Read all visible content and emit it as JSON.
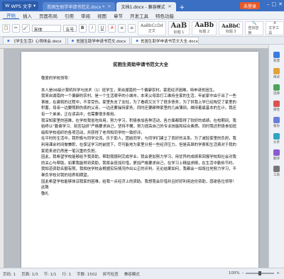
{
  "titlebar": {
    "app_label": "WPS 文字",
    "tabs": [
      {
        "label": "贫困生助学申请书范文.docx *"
      },
      {
        "label": "文档1.docx - 兼容模式"
      }
    ],
    "login_label": "未登录"
  },
  "menu": {
    "items": [
      "开始",
      "插入",
      "页面布局",
      "引用",
      "审阅",
      "视图",
      "章节",
      "开发工具",
      "特色功能"
    ]
  },
  "ribbon": {
    "font": "宋体",
    "size": "五号",
    "styles": [
      {
        "preview": "AaBbCcDd",
        "name": "正文"
      },
      {
        "preview": "AaB",
        "name": "标题 1"
      },
      {
        "preview": "AaBb",
        "name": "标题 2"
      },
      {
        "preview": "AaBbC",
        "name": "标题 3"
      }
    ],
    "find_label": "查找替换",
    "select_label": "选择",
    "tools_label": "文字工具"
  },
  "quickbar": {
    "tabs": [
      {
        "label": "《学生生活》心得体会.docx"
      },
      {
        "label": "贫困生助学申请书范文.docx"
      },
      {
        "label": "贫困生助学申请书范文大全.docx"
      }
    ]
  },
  "document": {
    "title": "贫困生资助申请书范文大全",
    "salutation": "敬爱的学校领导：",
    "paragraphs": [
      "本人是06级计算机科学与技术（1）班学生，来自湖南的一个偏僻农村。家庭经济困难，特申请贫困生。",
      "我来自湖南的一个偏僻的农村。是一个生活艰辛的小城市，本来父母靠打工维持全家的生活，年前家中由于出了一些事故，在建筑的过程中，不幸受伤。家里失去了支柱，为了看病又欠下了很多债务，为了供我上学已经掏空了家里的积蓄。母亲一边要照顾伤病的父亲，一边还要操持家务，同时还要耕种家里的几亩薄田，维持着最基本的生计。我还有一个弟弟，正在读高中，也需要很多费用。",
      "我深知家里的困难，在学校我省吃俭用，努力学习，积极参加各种活动，各方面都取得了较好的成绩。在校期间，我始终以“勤奋学习、刻苦钻研”严格要求自己，坚持不懈，努力提高自己的专业技能和综合素质。同时我还积极参加班级和学校组织的各项活动，并获得了老师和同学的一致好评。",
      "在平时的生活中，我积极与同学交流，乐于助人，团结同学，与同学们建立了良好的关系。为了减轻家里的负担，我利用课余时间做兼职，在保证学习的前提下，尽可能地为家里分担一些经济压力。但是高昂的学费和生活费对于我的家庭来说仍然是一笔沉重的负担。",
      "因此，我希望学校能够给予我资助，帮助我顺利完成学业。我会更加努力学习，用优异的成绩来回报学校和社会对我的关心与帮助。如果我能得到资助，我将会倍加珍惜，更加严格要求自己，在学习上精益求精，在生活中勤俭节约。",
      "我知道资助名额有限，我相信学校会根据实际情况作出公正的评判。无论结果如何，我都会一如既往地努力学习，不辜负学校对我的培养和期望。",
      "因此希望学校能够体谅我家的困难，给我一点经济上的资助。我想我会珍惜并且好好利用这份资助，感谢各位领导！"
    ],
    "closing": "此致",
    "regards": "敬礼"
  },
  "sidepanel": {
    "items": [
      {
        "label": "新建",
        "icon": "new-doc-icon",
        "color": "#3b7be0"
      },
      {
        "label": "样式",
        "icon": "style-icon",
        "color": "#e2a23a"
      },
      {
        "label": "选择",
        "icon": "cursor-icon",
        "color": "#4fa35a"
      },
      {
        "label": "属性",
        "icon": "properties-icon",
        "color": "#d9534f"
      },
      {
        "label": "备份",
        "icon": "backup-icon",
        "color": "#6b7fd8"
      },
      {
        "label": "分享",
        "icon": "share-icon",
        "color": "#2fa3c4"
      },
      {
        "label": "翻译",
        "icon": "translate-icon",
        "color": "#8a5bd0"
      },
      {
        "label": "工具",
        "icon": "tools-icon",
        "color": "#777777"
      }
    ]
  },
  "statusbar": {
    "page": "页码: 1",
    "pages": "页面: 1/3",
    "section": "节: 1/1",
    "row": "行: 1",
    "words": "字数: 1502",
    "spell": "拼写检查",
    "mode": "兼容模式",
    "zoom": "100%"
  },
  "colors": {
    "titlebar": "#3a6fc4",
    "accent": "#1f5fbf",
    "login": "#e85a2a"
  }
}
